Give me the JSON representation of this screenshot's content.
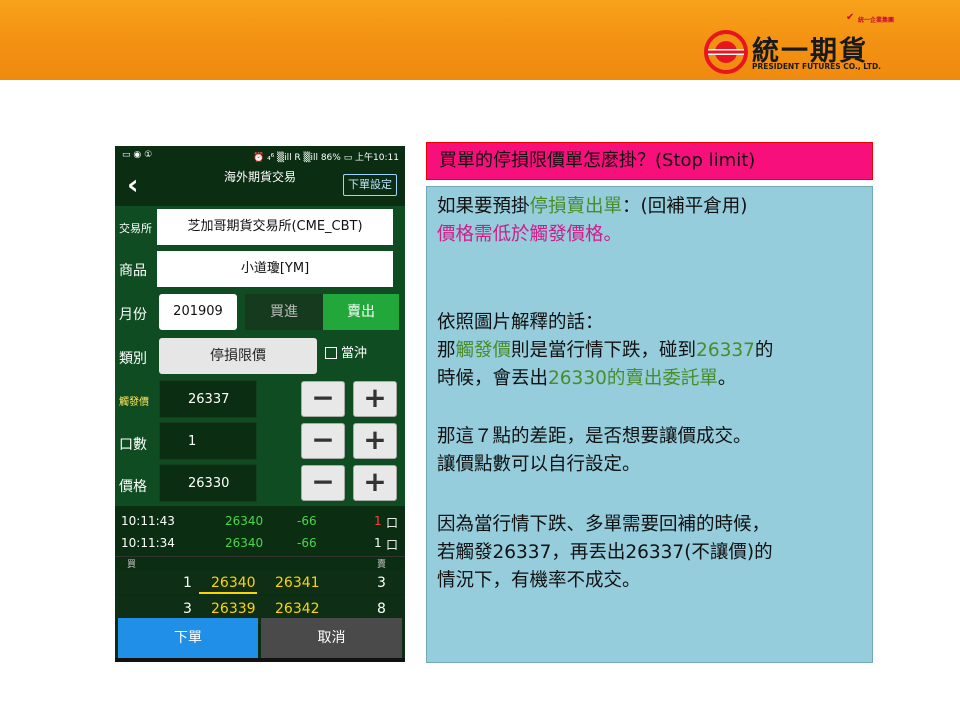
{
  "header": {
    "logo_tagline": "統一企業集團",
    "logo_name": "統一期貨",
    "logo_en": "PRESIDENT FUTURES CO., LTD.",
    "brand_color": "#e8151f",
    "bar_color": "#f39112"
  },
  "phone": {
    "statusbar": {
      "left_icons": "▭ ◉ ①",
      "right": "⏰ ₄⁶ ▒ill R ▒ill 86% ▭ 上午10:11"
    },
    "appbar": {
      "back_glyph": "‹",
      "title": "海外期貨交易",
      "settings_button": "下單設定"
    },
    "form": {
      "exchange_label": "交易所",
      "exchange_value": "芝加哥期貨交易所(CME_CBT)",
      "product_label": "商品",
      "product_value": "小道瓊[YM]",
      "month_label": "月份",
      "month_value": "201909",
      "buy_label": "買進",
      "sell_label": "賣出",
      "type_label": "類別",
      "type_value": "停損限價",
      "offset_label": "當沖",
      "trigger_label": "觸發價",
      "trigger_value": "26337",
      "qty_label": "口數",
      "qty_value": "1",
      "price_label": "價格",
      "price_value": "26330",
      "minus": "−",
      "plus": "+"
    },
    "ticks": [
      {
        "time": "10:11:43",
        "price": "26340",
        "change": "-66",
        "qty": "1",
        "unit": "口"
      },
      {
        "time": "10:11:34",
        "price": "26340",
        "change": "-66",
        "qty": "1",
        "unit": "口"
      }
    ],
    "book": {
      "bid_header": "買",
      "ask_header": "賣",
      "rows": [
        {
          "bid_qty": "1",
          "bid": "26340",
          "ask": "26341",
          "ask_qty": "3"
        },
        {
          "bid_qty": "3",
          "bid": "26339",
          "ask": "26342",
          "ask_qty": "8"
        }
      ]
    },
    "buttons": {
      "submit": "下單",
      "cancel": "取消"
    }
  },
  "panel": {
    "title": "買單的停損限價單怎麼掛？(Stop limit)",
    "p1_prefix": "如果要預掛",
    "p1_green": "停損賣出單",
    "p1_suffix": "：(回補平倉用)",
    "p1_line2": "價格需低於觸發價格。",
    "p2_line1": "依照圖片解釋的話：",
    "p2_l2_a": "那",
    "p2_l2_green1": "觸發價",
    "p2_l2_b": "則是當行情下跌，碰到",
    "p2_l2_green2": "26337",
    "p2_l2_c": "的",
    "p2_l3_a": "時候，會丟出",
    "p2_l3_green": "26330的賣出委託單",
    "p2_l3_b": "。",
    "p3_line1": "那這７點的差距，是否想要讓價成交。",
    "p3_line2": "讓價點數可以自行設定。",
    "p4_line1": "因為當行情下跌、多單需要回補的時候，",
    "p4_line2": "若觸發26337，再丟出26337(不讓價)的",
    "p4_line3": "情況下，有機率不成交。"
  }
}
